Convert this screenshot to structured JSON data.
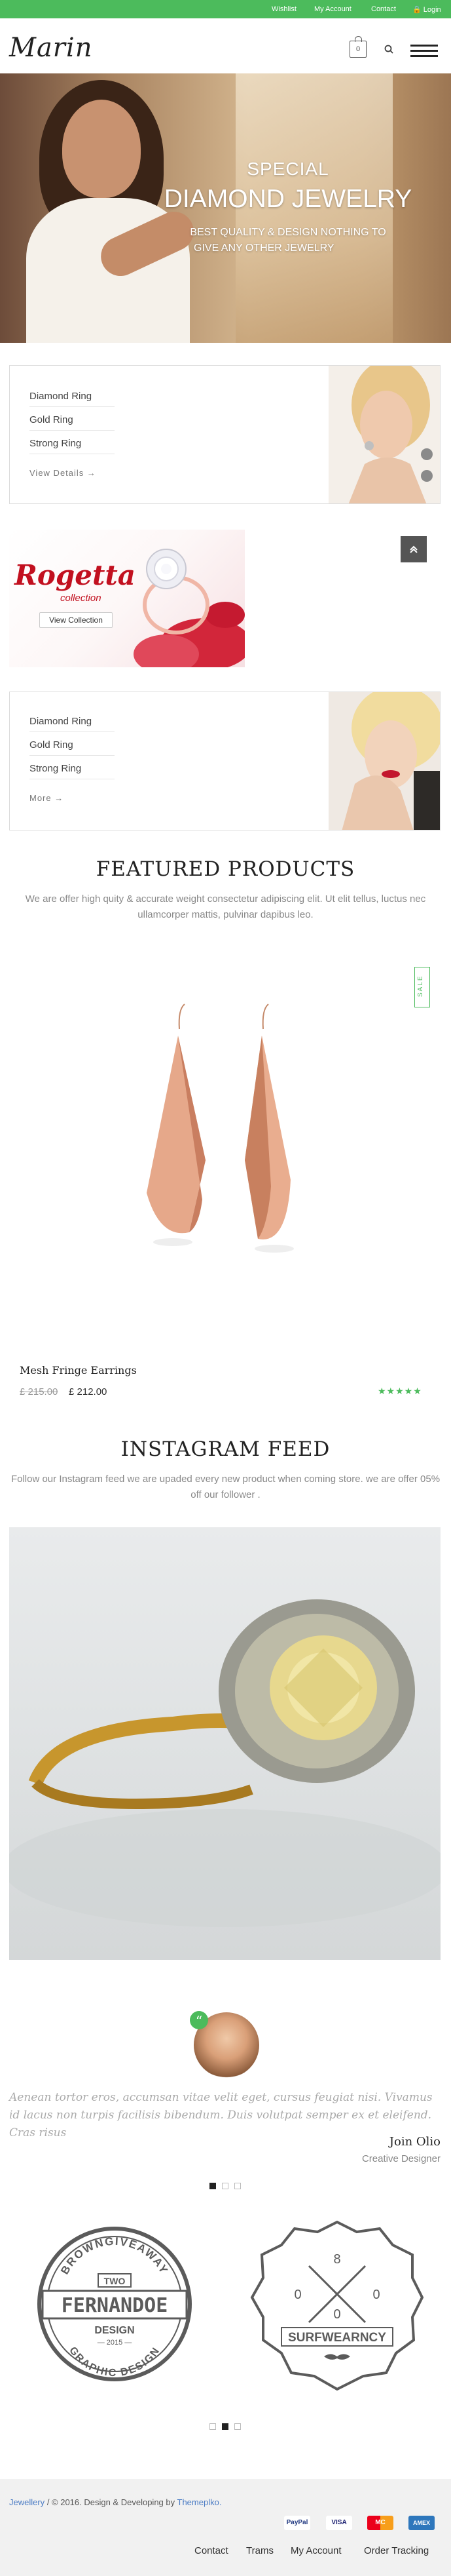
{
  "topbar": {
    "wishlist": "Wishlist",
    "account": "My Account",
    "contact": "Contact",
    "login": "🔒 Login"
  },
  "header": {
    "logo": "Marin",
    "cart_count": "0"
  },
  "hero": {
    "line1": "SPECIAL",
    "line2": "DIAMOND JEWELRY",
    "line3": "BEST QUALITY & DESIGN NOTHING TO",
    "line4": "GIVE ANY OTHER JEWELRY"
  },
  "category_box_1": {
    "items": [
      "Diamond Ring",
      "Gold Ring",
      "Strong Ring"
    ],
    "link": "View Details →"
  },
  "rogetta": {
    "title": "Rogetta",
    "subtitle": "collection",
    "button": "View Collection"
  },
  "category_box_2": {
    "items": [
      "Diamond Ring",
      "Gold Ring",
      "Strong Ring"
    ],
    "link": "More →"
  },
  "featured": {
    "title": "FEATURED PRODUCTS",
    "desc": "We are offer high quity & accurate weight consectetur adipiscing elit. Ut elit tellus, luctus nec ullamcorper mattis, pulvinar dapibus leo.",
    "product": {
      "badge": "SALE",
      "name": "Mesh Fringe Earrings",
      "old_price": "£ 215.00",
      "new_price": "£ 212.00",
      "rating": 5,
      "stars": "★★★★★"
    }
  },
  "instagram": {
    "title": "INSTAGRAM FEED",
    "desc": "Follow our Instagram feed we are upaded every new product when coming store. we are offer 05% off our follower ."
  },
  "testimonial": {
    "text": "Aenean tortor eros, accumsan vitae velit eget, cursus feugiat nisi. Vivamus id lacus non turpis facilisis bibendum. Duis volutpat semper ex et eleifend. Cras risus",
    "name": "Join Olio",
    "role": "Creative Designer"
  },
  "logos": {
    "fernandoe": {
      "top": "BROWNGIVEAWAY",
      "number": "TWO",
      "name": "FERNANDOE",
      "design": "DESIGN",
      "year": "2015",
      "bottom": "GRAPHIC DESIGN"
    },
    "surfwearncy": {
      "top": "8",
      "bottom": "0",
      "name": "SURFWEARNCY"
    }
  },
  "footer": {
    "copyright_prefix": "Jewellery",
    "copyright_text": "/  © 2016. Design & Developing by",
    "brand": "Themeplko.",
    "payments": [
      "PayPal",
      "VISA",
      "MC",
      "AMEX"
    ],
    "links": [
      "Contact",
      "Trams",
      "My Account",
      "Order Tracking"
    ]
  },
  "colors": {
    "accent": "#4cbb5c",
    "dark": "#222222",
    "muted": "#888888"
  }
}
